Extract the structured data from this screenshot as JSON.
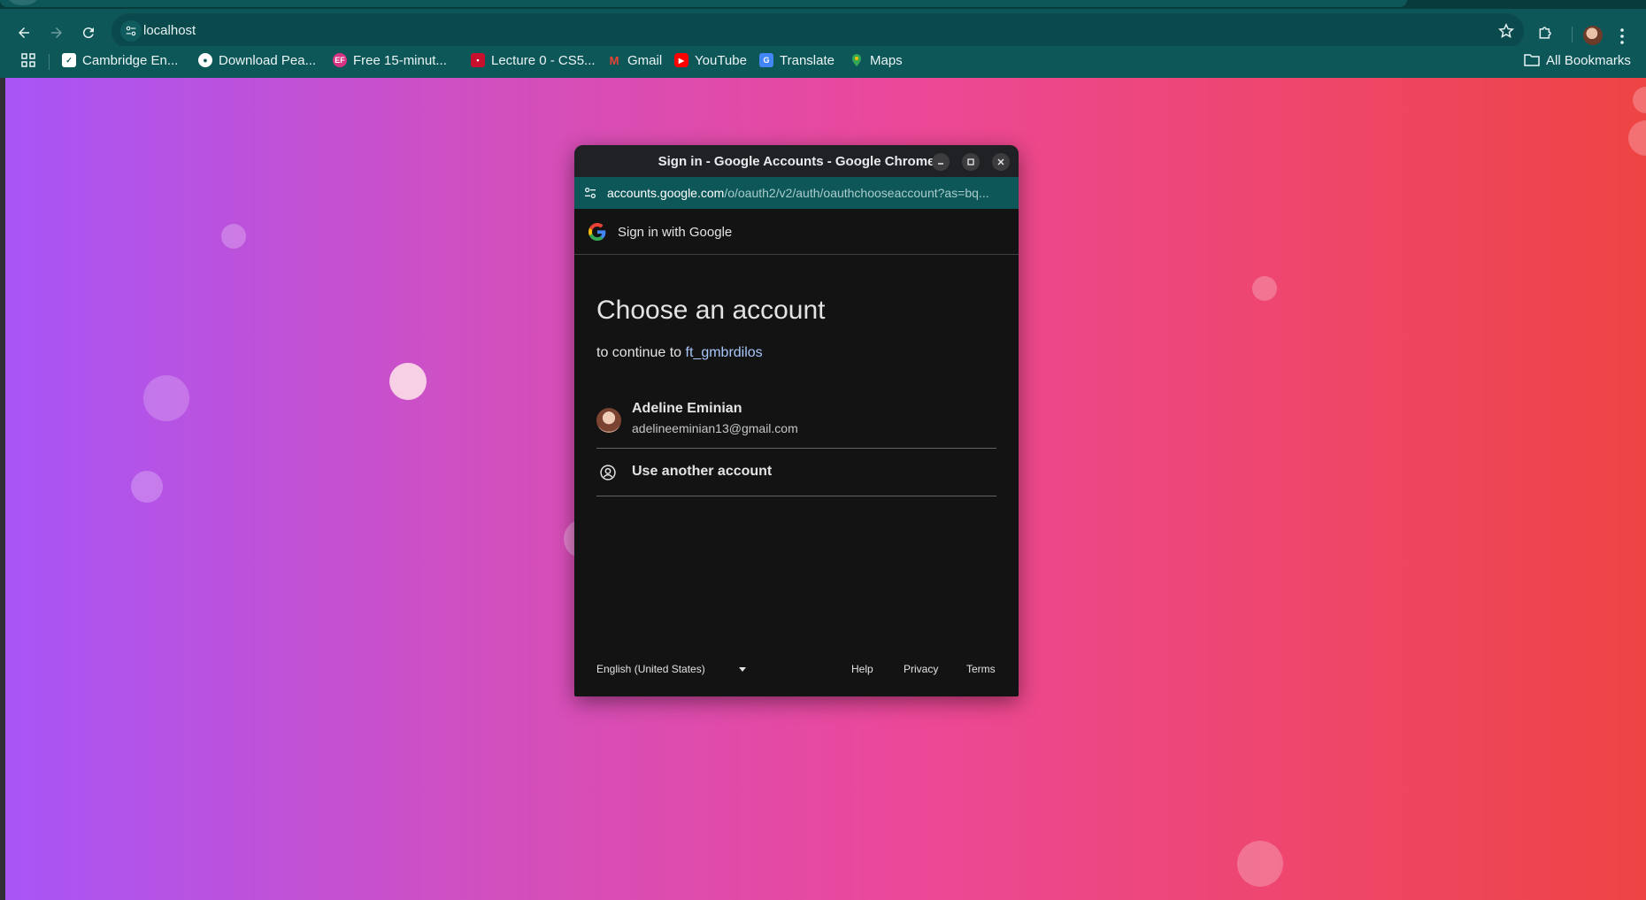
{
  "browser": {
    "url": "localhost",
    "bookmarks": [
      {
        "label": "Cambridge En...",
        "icon": "check-icon",
        "color": "#ffffff"
      },
      {
        "label": "Download Pea...",
        "icon": "globe-icon",
        "color": "#ffffff"
      },
      {
        "label": "Free 15-minut...",
        "icon": "ef-logo-icon",
        "color": "#d63384"
      },
      {
        "label": "Lecture 0 - CS5...",
        "icon": "harvard-shield-icon",
        "color": "#c8102e"
      },
      {
        "label": "Gmail",
        "icon": "gmail-icon",
        "color": "#ea4335"
      },
      {
        "label": "YouTube",
        "icon": "youtube-icon",
        "color": "#ff0000"
      },
      {
        "label": "Translate",
        "icon": "translate-icon",
        "color": "#4285f4"
      },
      {
        "label": "Maps",
        "icon": "maps-pin-icon",
        "color": "#34a853"
      }
    ],
    "all_bookmarks_label": "All Bookmarks"
  },
  "popup": {
    "window_title": "Sign in - Google Accounts - Google Chrome",
    "url_host": "accounts.google.com",
    "url_path": "/o/oauth2/v2/auth/oauthchooseaccount?as=bq...",
    "header_label": "Sign in with Google",
    "heading": "Choose an account",
    "continue_prefix": "to continue to",
    "app_name": "ft_gmbrdilos",
    "account": {
      "name": "Adeline Eminian",
      "email": "adelineeminian13@gmail.com"
    },
    "use_another_label": "Use another account",
    "footer": {
      "language": "English (United States)",
      "help": "Help",
      "privacy": "Privacy",
      "terms": "Terms"
    }
  },
  "colors": {
    "chrome_teal": "#0e5759",
    "gradient_start": "#a855f7",
    "gradient_end": "#ef4444",
    "link_blue": "#a8c7fa"
  }
}
